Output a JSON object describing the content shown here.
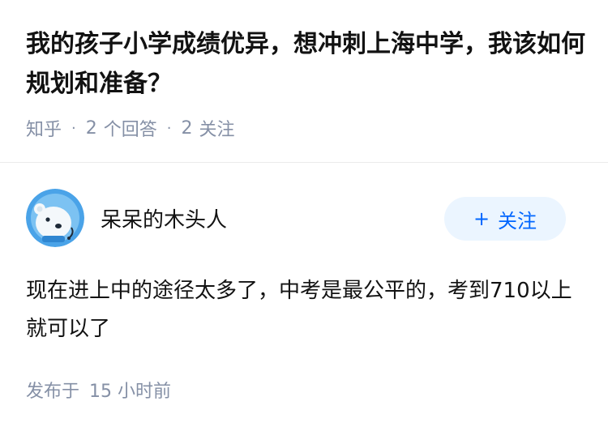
{
  "question": {
    "title": "我的孩子小学成绩优异，想冲刺上海中学，我该如何规划和准备？",
    "source": "知乎",
    "answers_count": "2",
    "answers_label": "个回答",
    "followers_count": "2",
    "followers_label": "关注"
  },
  "answer": {
    "author": "呆呆的木头人",
    "avatar_icon": "cartoon-polar-bear-avatar-icon",
    "follow_button": {
      "icon": "plus-icon",
      "label": "关注"
    },
    "content": "现在进上中的途径太多了，中考是最公平的，考到710以上就可以了",
    "published_label": "发布于",
    "published_time": "15 小时前"
  },
  "colors": {
    "accent": "#0066ff",
    "button_bg": "#ebf5ff",
    "meta_text": "#8590a6",
    "avatar_bg": "#4aa3e8"
  }
}
